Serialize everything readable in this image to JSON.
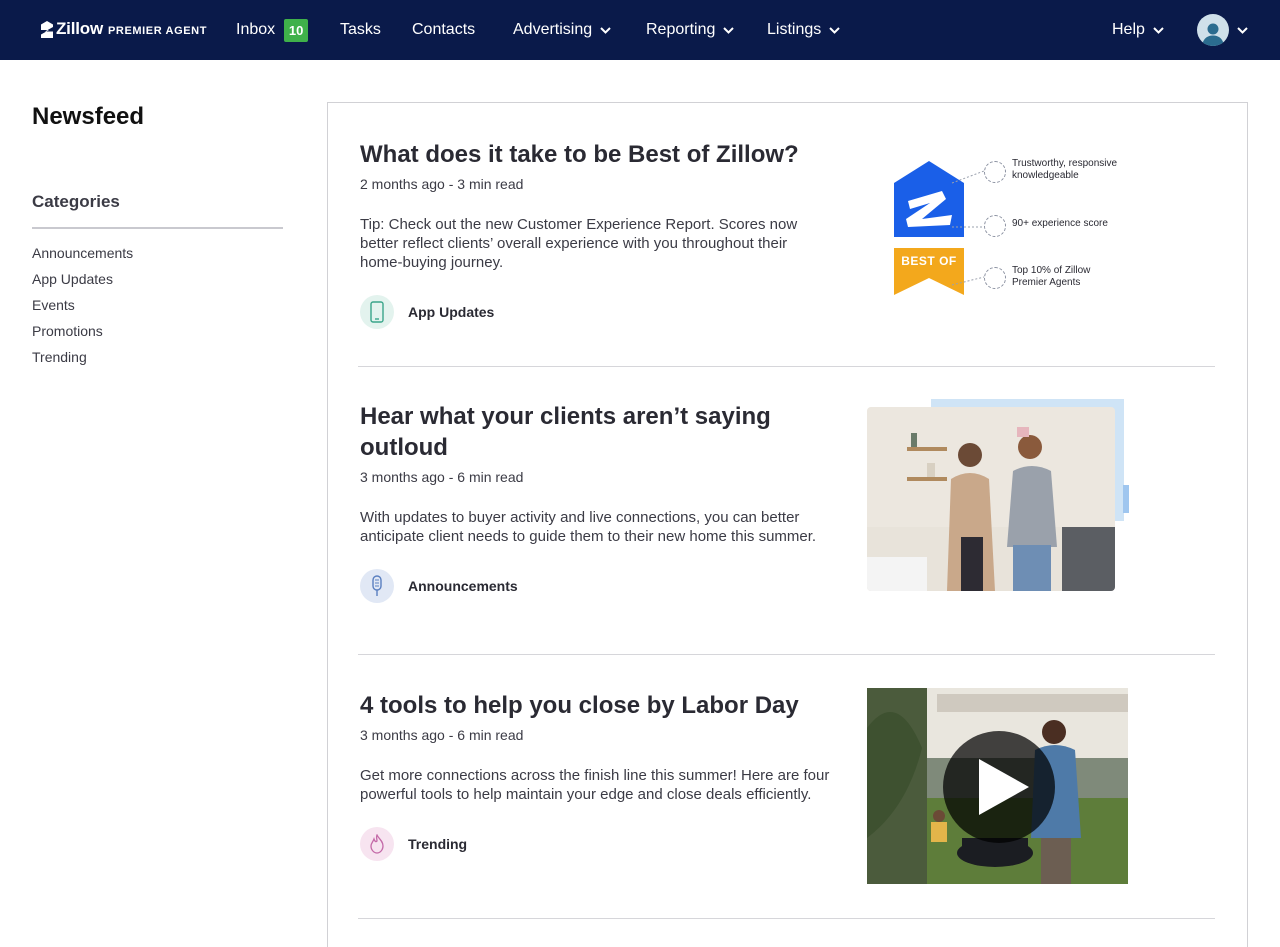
{
  "nav": {
    "logo_word": "Zillow",
    "logo_sub": "PREMIER AGENT",
    "inbox_label": "Inbox",
    "inbox_count": "10",
    "tasks_label": "Tasks",
    "contacts_label": "Contacts",
    "advertising_label": "Advertising",
    "reporting_label": "Reporting",
    "listings_label": "Listings",
    "help_label": "Help"
  },
  "sidebar": {
    "title": "Newsfeed",
    "categories_title": "Categories",
    "categories": [
      "Announcements",
      "App Updates",
      "Events",
      "Promotions",
      "Trending"
    ]
  },
  "articles": [
    {
      "title": "What does it take to be Best of Zillow?",
      "meta": "2 months ago - 3 min read",
      "body": "Tip: Check out the new Customer Experience Report. Scores now better reflect clients’ overall experience with you throughout their home-buying journey.",
      "tag": "App Updates",
      "image": {
        "badge_text": "BEST OF",
        "point_1": "Trustworthy, responsive knowledgeable",
        "point_2": "90+ experience score",
        "point_3": "Top 10% of Zillow Premier Agents"
      }
    },
    {
      "title": "Hear what your clients aren’t saying outloud",
      "meta": "3 months ago - 6 min read",
      "body": "With updates to buyer activity and live connections, you can better anticipate client needs to guide them to their new home this summer.",
      "tag": "Announcements"
    },
    {
      "title": "4 tools to help you close by Labor Day",
      "meta": "3 months ago - 6 min read",
      "body": "Get more connections across the finish line this summer! Here are four powerful tools to help maintain your edge and close deals efficiently.",
      "tag": "Trending"
    }
  ],
  "colors": {
    "nav_bg": "#0a1a4a",
    "badge_green": "#3fb14a",
    "zillow_blue": "#1a5fe8",
    "best_of_gold": "#f3a81c"
  }
}
